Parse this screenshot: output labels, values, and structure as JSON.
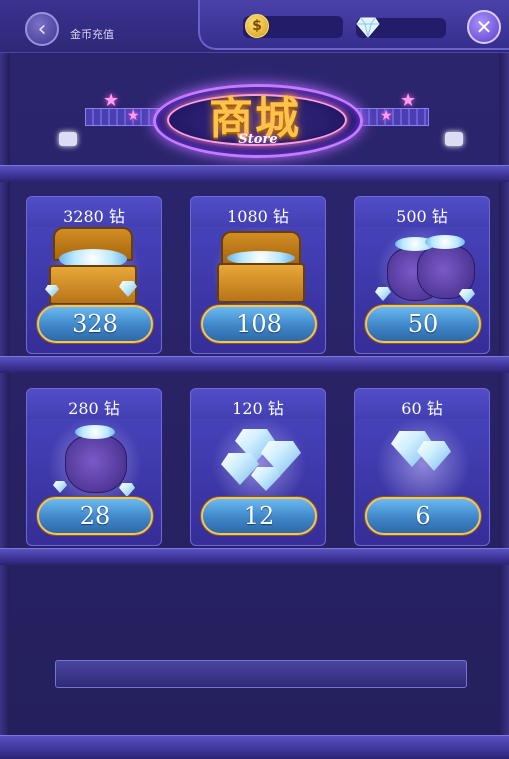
{
  "header": {
    "title": "金币充值",
    "back_icon": "chevron-left-icon",
    "coin_icon_glyph": "$",
    "close_glyph": "✕"
  },
  "sign": {
    "title": "商城",
    "subtitle": "Store"
  },
  "products": [
    {
      "amount": "3280 钻",
      "price": "328",
      "art": "big-chest"
    },
    {
      "amount": "1080 钻",
      "price": "108",
      "art": "chest"
    },
    {
      "amount": "500 钻",
      "price": "50",
      "art": "double-bag"
    },
    {
      "amount": "280 钻",
      "price": "28",
      "art": "bag"
    },
    {
      "amount": "120 钻",
      "price": "12",
      "art": "diamond-cluster"
    },
    {
      "amount": "60 钻",
      "price": "6",
      "art": "diamonds"
    }
  ],
  "colors": {
    "background": "#2a2468",
    "price_button": "#3f86c8",
    "price_border": "#f1c467",
    "sign_text": "#ffc24a"
  }
}
